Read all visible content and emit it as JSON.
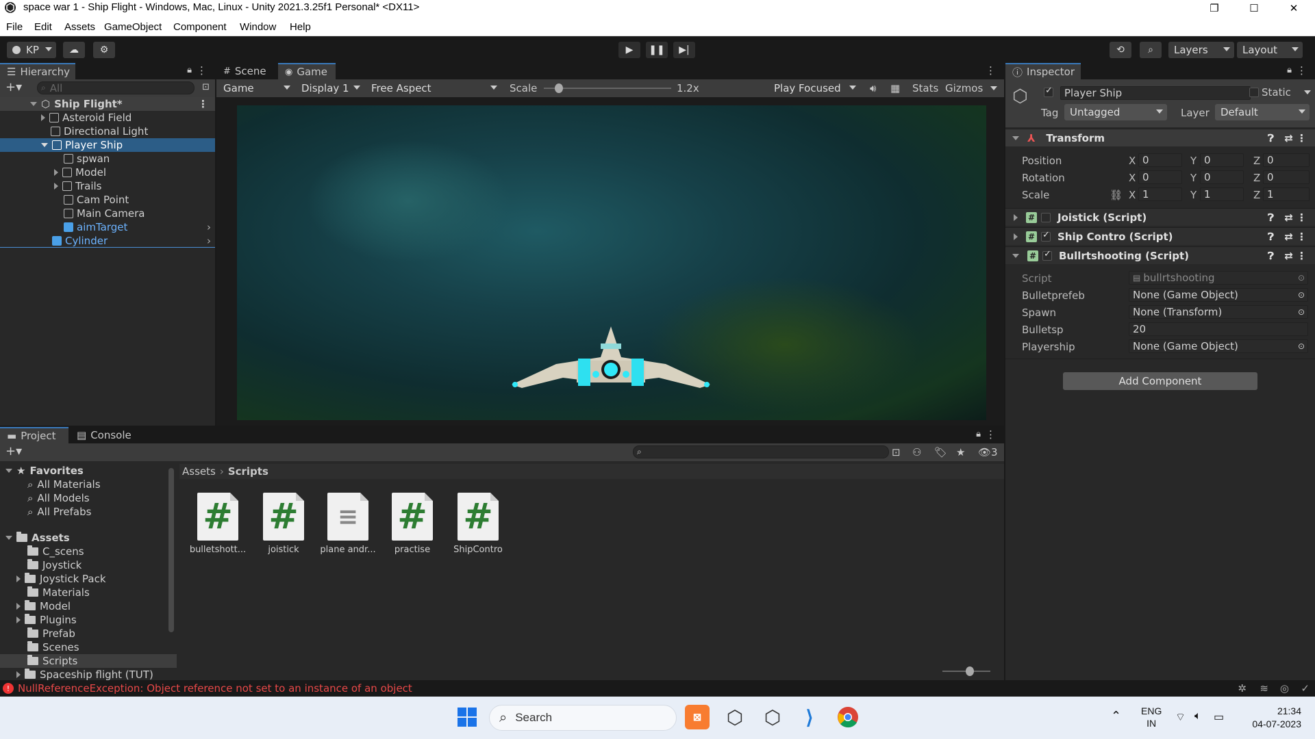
{
  "window": {
    "title": "space war 1 - Ship Flight - Windows, Mac, Linux - Unity 2021.3.25f1 Personal* <DX11>"
  },
  "menu": [
    "File",
    "Edit",
    "Assets",
    "GameObject",
    "Component",
    "Window",
    "Help"
  ],
  "toolbar": {
    "account": "KP",
    "layers": "Layers",
    "layout": "Layout"
  },
  "hierarchy": {
    "tab": "Hierarchy",
    "search_placeholder": "All",
    "scene": "Ship Flight*",
    "items": [
      {
        "label": "Asteroid Field"
      },
      {
        "label": "Directional Light"
      },
      {
        "label": "Player Ship"
      },
      {
        "label": "spwan"
      },
      {
        "label": "Model"
      },
      {
        "label": "Trails"
      },
      {
        "label": "Cam Point"
      },
      {
        "label": "Main Camera"
      },
      {
        "label": "aimTarget"
      },
      {
        "label": "Cylinder"
      }
    ]
  },
  "game_view": {
    "tabs": [
      "Scene",
      "Game"
    ],
    "mode": "Game",
    "display": "Display 1",
    "aspect": "Free Aspect",
    "scale_label": "Scale",
    "scale_value": "1.2x",
    "play_mode": "Play Focused",
    "stats": "Stats",
    "gizmos": "Gizmos"
  },
  "inspector": {
    "tab": "Inspector",
    "object_name": "Player Ship",
    "static_label": "Static",
    "tag_label": "Tag",
    "tag_value": "Untagged",
    "layer_label": "Layer",
    "layer_value": "Default",
    "transform": {
      "title": "Transform",
      "position_label": "Position",
      "rotation_label": "Rotation",
      "scale_label": "Scale",
      "position": {
        "x": "0",
        "y": "0",
        "z": "0"
      },
      "rotation": {
        "x": "0",
        "y": "0",
        "z": "0"
      },
      "scale": {
        "x": "1",
        "y": "1",
        "z": "1"
      }
    },
    "components": [
      {
        "title": "Joistick (Script)"
      },
      {
        "title": "Ship Contro (Script)"
      },
      {
        "title": "Bullrtshooting (Script)"
      }
    ],
    "bullet_fields": {
      "script_label": "Script",
      "script_value": "bullrtshooting",
      "bulletprefeb_label": "Bulletprefeb",
      "bulletprefeb_value": "None (Game Object)",
      "spawn_label": "Spawn",
      "spawn_value": "None (Transform)",
      "bulletsp_label": "Bulletsp",
      "bulletsp_value": "20",
      "playership_label": "Playership",
      "playership_value": "None (Game Object)"
    },
    "add_component": "Add Component"
  },
  "project": {
    "tabs": [
      "Project",
      "Console"
    ],
    "hidden_count": "3",
    "favorites_label": "Favorites",
    "favorites": [
      "All Materials",
      "All Models",
      "All Prefabs"
    ],
    "assets_label": "Assets",
    "folders": [
      "C_scens",
      "Joystick",
      "Joystick Pack",
      "Materials",
      "Model",
      "Plugins",
      "Prefab",
      "Scenes",
      "Scripts",
      "Spaceship flight (TUT)"
    ],
    "breadcrumb": [
      "Assets",
      "Scripts"
    ],
    "files": [
      "bulletshott...",
      "joistick",
      "plane andr...",
      "practise",
      "ShipContro"
    ]
  },
  "status": {
    "error": "NullReferenceException: Object reference not set to an instance of an object"
  },
  "taskbar": {
    "search": "Search",
    "lang1": "ENG",
    "lang2": "IN",
    "time": "21:34",
    "date": "04-07-2023"
  }
}
